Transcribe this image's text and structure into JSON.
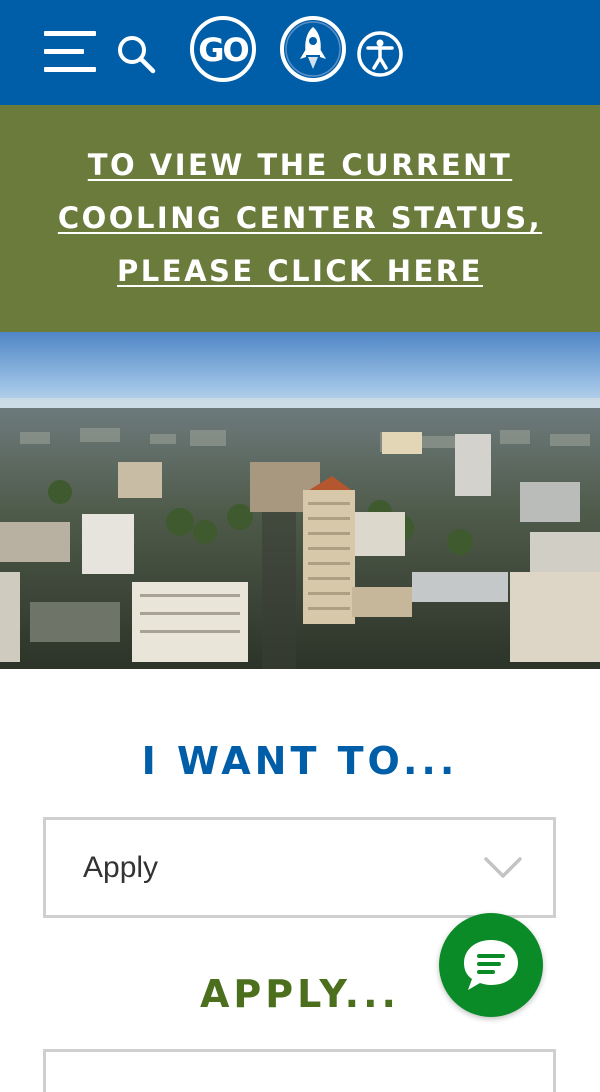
{
  "header": {
    "icons": [
      "menu-icon",
      "search-icon",
      "go-icon",
      "rocket-icon",
      "accessibility-icon"
    ],
    "go_logo_text": "GO"
  },
  "alert_banner": {
    "link_text": "TO VIEW THE CURRENT COOLING CENTER STATUS, PLEASE CLICK HERE",
    "background_color": "#6a7b3c"
  },
  "hero": {
    "image": "aerial-city-skyline"
  },
  "i_want_to": {
    "heading": "I WANT TO...",
    "select_value": "Apply"
  },
  "apply_section": {
    "heading": "APPLY..."
  },
  "chat": {
    "icon": "chat-bubble-icon"
  },
  "colors": {
    "header_blue": "#005ea8",
    "banner_green": "#6a7b3c",
    "apply_green": "#4b6f1d",
    "chat_green": "#0b8a28"
  }
}
